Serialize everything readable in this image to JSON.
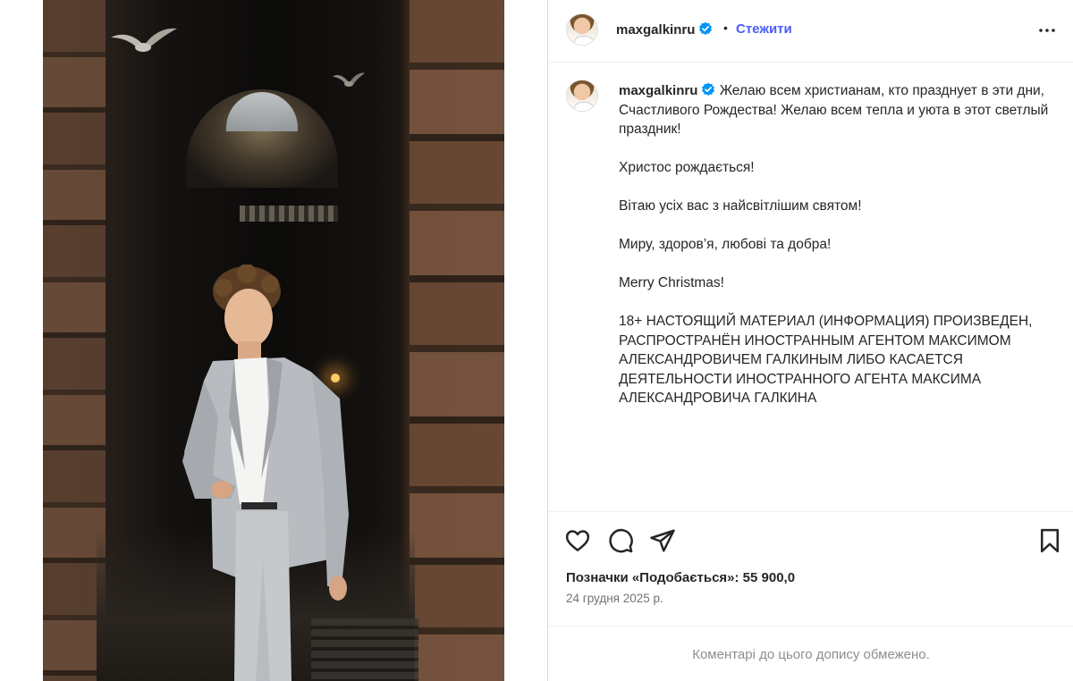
{
  "post": {
    "username": "maxgalkinru",
    "follow_label": "Стежити",
    "separator": "•",
    "caption": {
      "first_line": "Желаю всем христианам, кто празднует в эти дни, Счастливого Рождества! Желаю всем тепла и уюта в этот светлый праздник!",
      "paragraphs": [
        "Христос рождається!",
        "Вітаю усіх вас з найсвітлішим святом!",
        "Миру, здоров’я, любові та добра!",
        "Merry Christmas!",
        "18+ НАСТОЯЩИЙ МАТЕРИАЛ (ИНФОРМАЦИЯ) ПРОИЗВЕДЕН, РАСПРОСТРАНЁН ИНОСТРАННЫМ АГЕНТОМ МАКСИМОМ АЛЕКСАНДРОВИЧЕМ ГАЛКИНЫМ ЛИБО КАСАЕТСЯ ДЕЯТЕЛЬНОСТИ ИНОСТРАННОГО АГЕНТА МАКСИМА АЛЕКСАНДРОВИЧА ГАЛКИНА"
      ]
    },
    "likes_text": "Позначки «Подобається»: 55 900,0",
    "date": "24 грудня 2025 р.",
    "comments_notice": "Коментарі до цього допису обмежено."
  },
  "icons": {
    "like": "heart-icon",
    "comment": "comment-icon",
    "share": "share-icon",
    "save": "bookmark-icon",
    "more": "more-options-icon",
    "verified": "verified-badge-icon"
  },
  "colors": {
    "follow": "#4a5df9",
    "verified": "#0095f6",
    "secondary_text": "#737373",
    "divider": "#dbdbdb"
  }
}
